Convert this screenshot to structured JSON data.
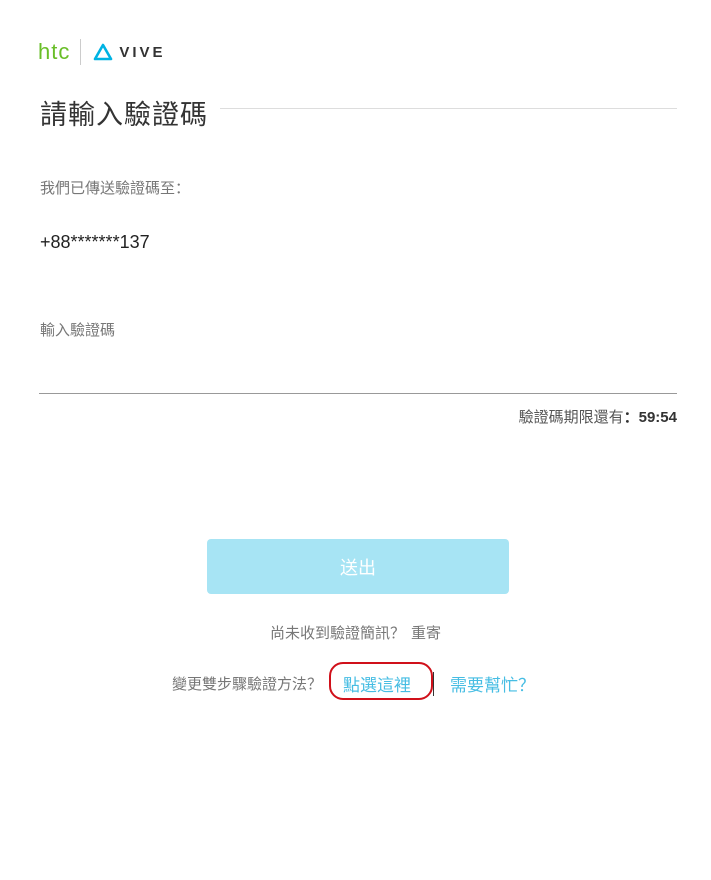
{
  "brand": {
    "htc": "htc",
    "vive": "VIVE",
    "htc_color": "#69be28",
    "vive_mark_color": "#00b3e3"
  },
  "title": "請輸入驗證碼",
  "sent_to_label": "我們已傳送驗證碼至：",
  "phone_masked": "+88*******137",
  "code_input": {
    "label": "輸入驗證碼",
    "value": ""
  },
  "expiry": {
    "label": "驗證碼期限還有",
    "separator": "：",
    "time": "59:54"
  },
  "submit_label": "送出",
  "resend": {
    "prompt": "尚未收到驗證簡訊？",
    "link": "重寄"
  },
  "change_method": {
    "prompt": "變更雙步驟驗證方法？",
    "link": "點選這裡",
    "highlighted": true
  },
  "help_link": "需要幫忙？",
  "colors": {
    "accent": "#46bde3",
    "button_disabled": "#a7e4f4",
    "highlight": "#d0101a"
  }
}
